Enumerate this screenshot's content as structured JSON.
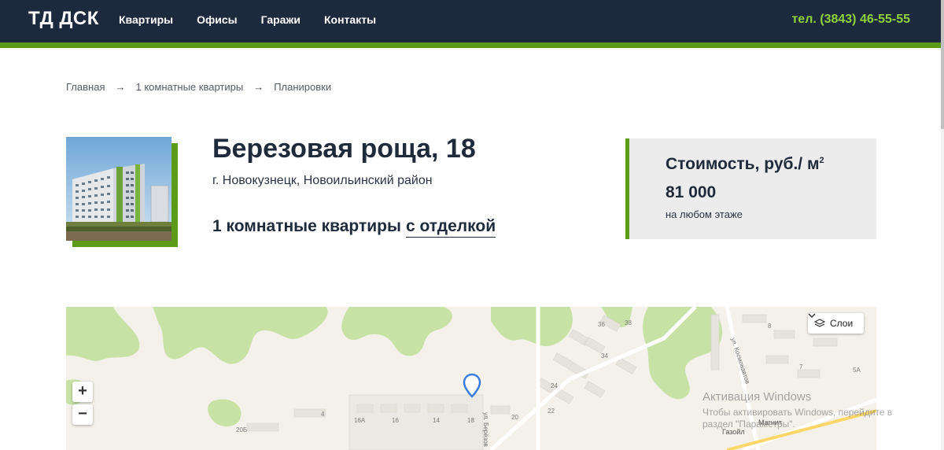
{
  "header": {
    "logo": "ТД ДСК",
    "nav": [
      "Квартиры",
      "Офисы",
      "Гаражи",
      "Контакты"
    ],
    "phone": "тел. (3843) 46-55-55"
  },
  "breadcrumb": {
    "items": [
      "Главная",
      "1 комнатные квартиры",
      "Планировки"
    ],
    "separator": "→"
  },
  "object": {
    "title": "Березовая роща, 18",
    "address": "г. Новокузнецк, Новоильинский район",
    "subtitle_prefix": "1 комнатные квартиры",
    "subtitle_link": "с отделкой"
  },
  "price": {
    "label": "Стоимость, руб./ м",
    "label_sup": "2",
    "value": "81 000",
    "note": "на любом этаже"
  },
  "map": {
    "zoom_in": "+",
    "zoom_out": "−",
    "layers_label": "Слои",
    "building_numbers": [
      "36",
      "38",
      "8",
      "34",
      "7",
      "24",
      "5А",
      "22",
      "4",
      "16А",
      "16",
      "14",
      "18",
      "20",
      "20Б"
    ],
    "streets": [
      "ул. Космонавтов",
      "ул. Берёзов"
    ],
    "pois": [
      "Магнит",
      "Газойл"
    ]
  },
  "watermark": {
    "title": "Активация Windows",
    "text": "Чтобы активировать Windows, перейдите в раздел \"Параметры\"."
  },
  "colors": {
    "header_bg": "#1d2a3e",
    "accent_green": "#5b9b17",
    "phone_green": "#8fd23a",
    "card_bg": "#ececec"
  }
}
